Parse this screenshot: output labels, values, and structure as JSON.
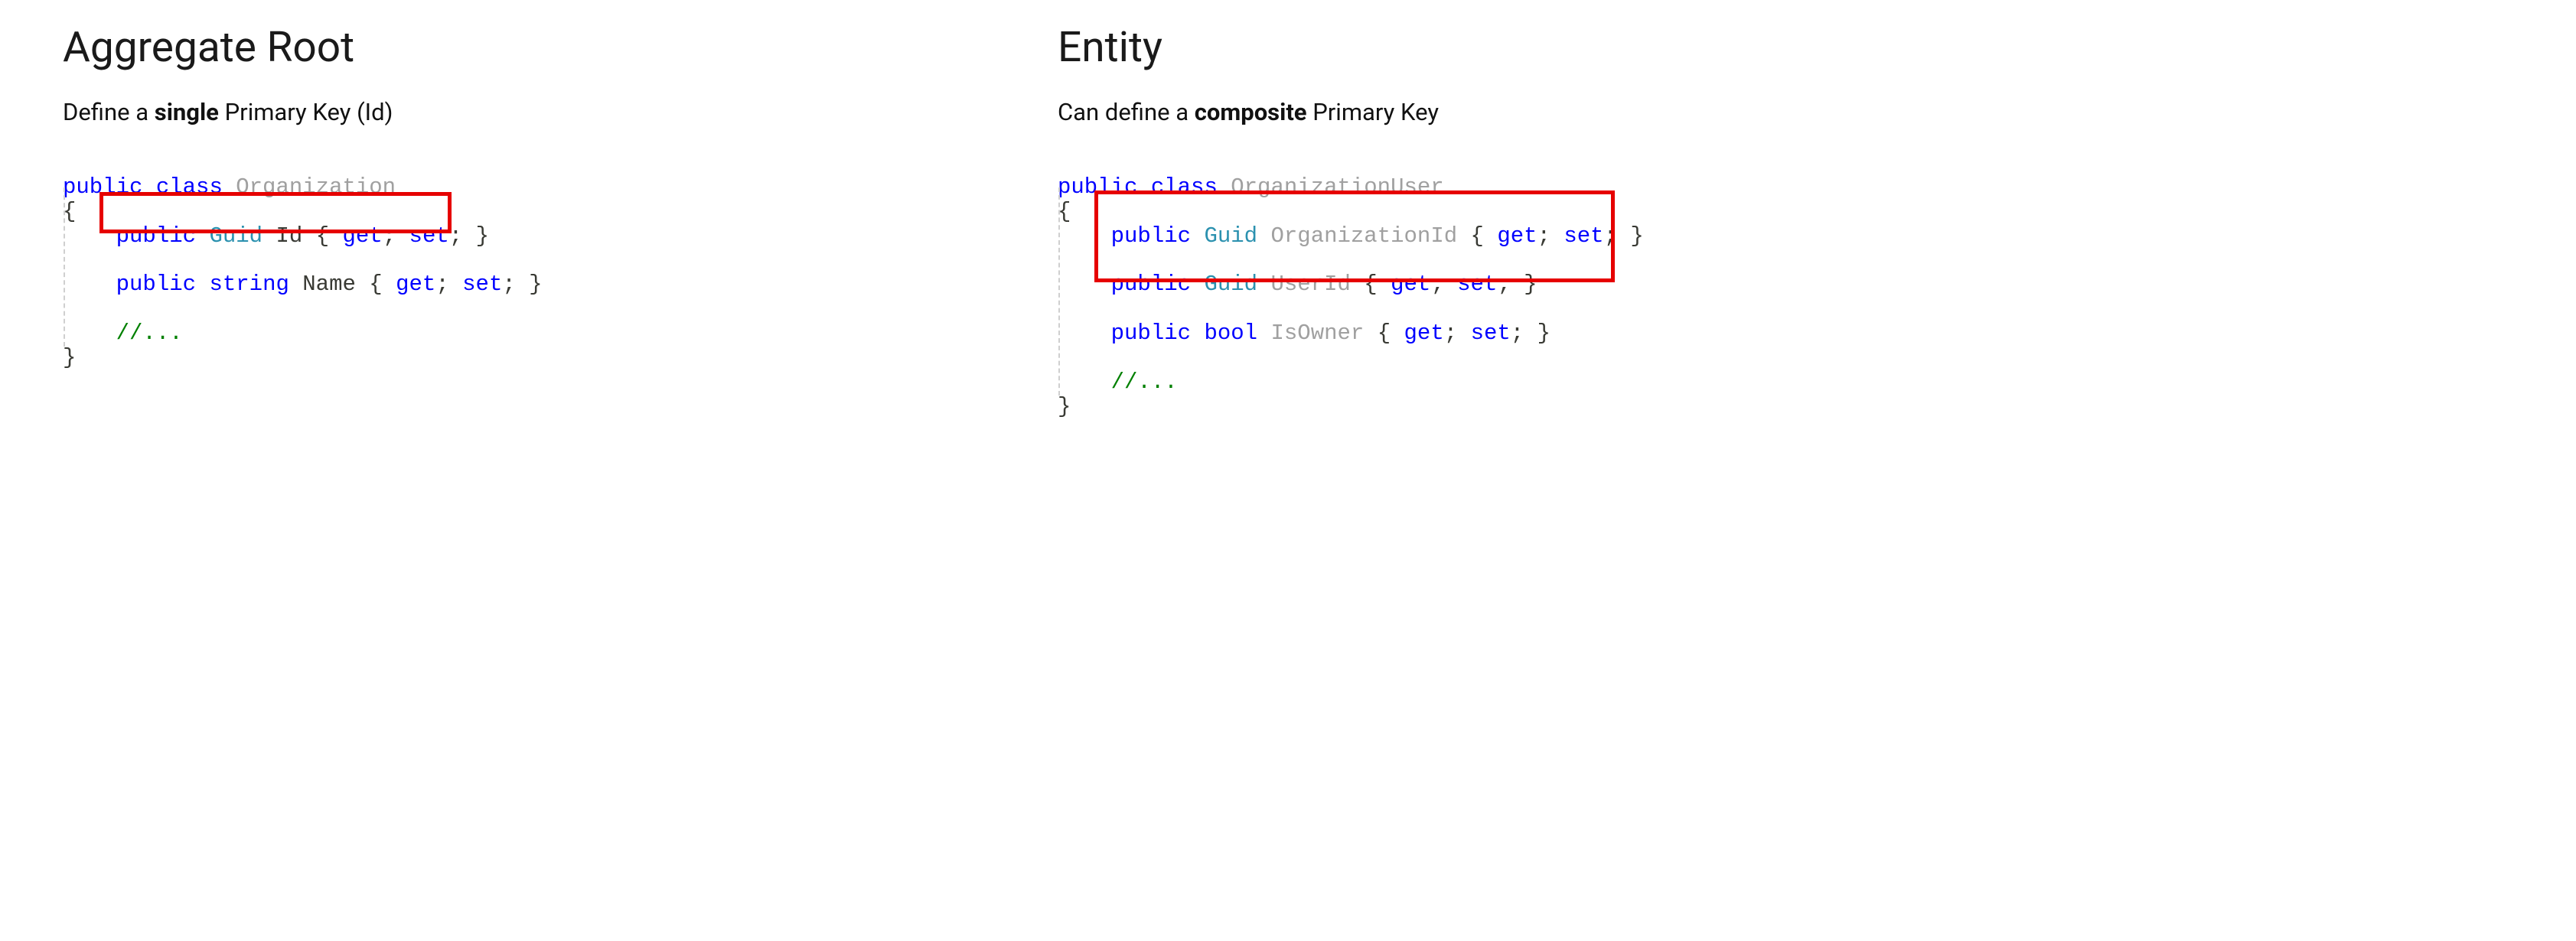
{
  "left": {
    "heading": "Aggregate Root",
    "subhead_pre": "Define a ",
    "subhead_bold": "single",
    "subhead_post": " Primary Key (Id)",
    "code": {
      "l1_kw1": "public",
      "l1_kw2": "class",
      "l1_cls": "Organization",
      "l2_brace": "{",
      "l3_indent": "    ",
      "l3_kw": "public",
      "l3_type": "Guid",
      "l3_name": "Id",
      "l3_rest": " { ",
      "l3_get": "get",
      "l3_sep": "; ",
      "l3_set": "set",
      "l3_end": "; }",
      "l4_spacer": "",
      "l5_indent": "    ",
      "l5_kw": "public",
      "l5_type": "string",
      "l5_name": "Name",
      "l5_rest": " { ",
      "l5_get": "get",
      "l5_sep": "; ",
      "l5_set": "set",
      "l5_end": "; }",
      "l6_spacer": "",
      "l7_indent": "    ",
      "l7_cmt": "//...",
      "l8_brace": "}"
    }
  },
  "right": {
    "heading": "Entity",
    "subhead_pre": "Can define a ",
    "subhead_bold": "composite",
    "subhead_post": " Primary Key",
    "code": {
      "l1_kw1": "public",
      "l1_kw2": "class",
      "l1_cls": "OrganizationUser",
      "l2_brace": "{",
      "l3_indent": "    ",
      "l3_kw": "public",
      "l3_type": "Guid",
      "l3_name": "OrganizationId",
      "l3_rest": " { ",
      "l3_get": "get",
      "l3_sep": "; ",
      "l3_set": "set",
      "l3_end": "; }",
      "l4_spacer": "",
      "l5_indent": "    ",
      "l5_kw": "public",
      "l5_type": "Guid",
      "l5_name": "UserId",
      "l5_rest": " { ",
      "l5_get": "get",
      "l5_sep": "; ",
      "l5_set": "set",
      "l5_end": "; }",
      "l6_spacer": "",
      "l7_indent": "    ",
      "l7_kw": "public",
      "l7_type": "bool",
      "l7_name": "IsOwner",
      "l7_rest": " { ",
      "l7_get": "get",
      "l7_sep": "; ",
      "l7_set": "set",
      "l7_end": "; }",
      "l8_spacer": "",
      "l9_indent": "    ",
      "l9_cmt": "//...",
      "l10_brace": "}"
    }
  }
}
